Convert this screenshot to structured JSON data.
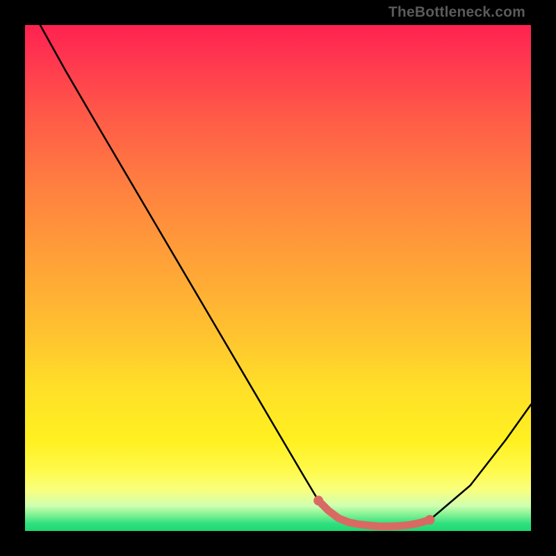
{
  "watermark": "TheBottleneck.com",
  "chart_data": {
    "type": "line",
    "title": "",
    "xlabel": "",
    "ylabel": "",
    "xlim": [
      0,
      100
    ],
    "ylim": [
      0,
      100
    ],
    "series": [
      {
        "name": "curve",
        "color": "#000000",
        "x": [
          3,
          8,
          15,
          25,
          35,
          45,
          55,
          58,
          62,
          67,
          72,
          77,
          80,
          88,
          95,
          100
        ],
        "y": [
          100,
          91,
          79,
          62,
          45,
          28,
          11,
          6,
          2.5,
          1.2,
          0.9,
          1.2,
          2.2,
          9,
          18,
          25
        ]
      },
      {
        "name": "highlight",
        "color": "#d96a63",
        "x": [
          58,
          60,
          62,
          64,
          66,
          68,
          70,
          72,
          74,
          76,
          78,
          80
        ],
        "y": [
          6,
          4,
          2.5,
          1.7,
          1.3,
          1.1,
          0.9,
          0.9,
          1.0,
          1.2,
          1.6,
          2.2
        ]
      }
    ]
  }
}
